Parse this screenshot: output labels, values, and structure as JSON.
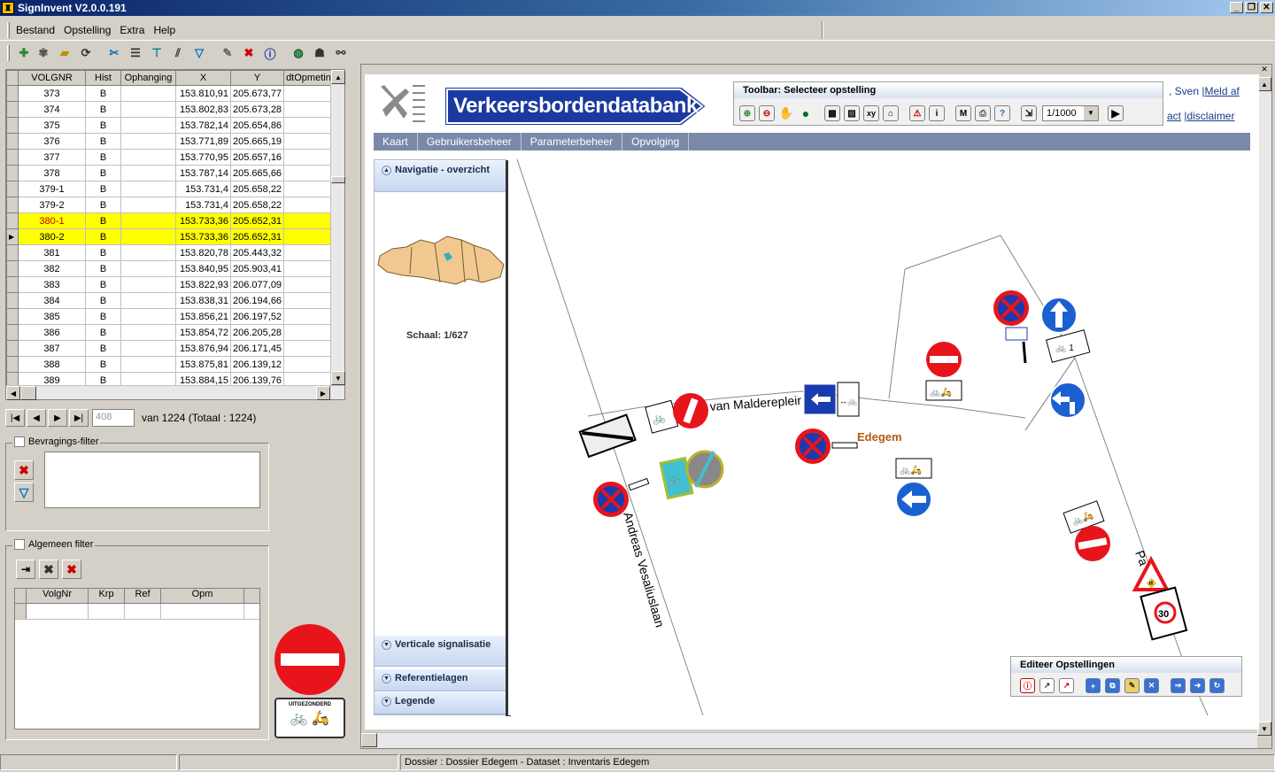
{
  "window": {
    "title": "SignInvent V2.0.0.191"
  },
  "menu": [
    "Bestand",
    "Opstelling",
    "Extra",
    "Help"
  ],
  "grid": {
    "columns": [
      "VOLGNR",
      "Hist",
      "Ophanging",
      "X",
      "Y",
      "dtOpmeting"
    ],
    "rows": [
      [
        "373",
        "B",
        "",
        "153.810,91",
        "205.673,77",
        ""
      ],
      [
        "374",
        "B",
        "",
        "153.802,83",
        "205.673,28",
        ""
      ],
      [
        "375",
        "B",
        "",
        "153.782,14",
        "205.654,86",
        ""
      ],
      [
        "376",
        "B",
        "",
        "153.771,89",
        "205.665,19",
        ""
      ],
      [
        "377",
        "B",
        "",
        "153.770,95",
        "205.657,16",
        ""
      ],
      [
        "378",
        "B",
        "",
        "153.787,14",
        "205.665,66",
        ""
      ],
      [
        "379-1",
        "B",
        "",
        "153.731,4",
        "205.658,22",
        ""
      ],
      [
        "379-2",
        "B",
        "",
        "153.731,4",
        "205.658,22",
        ""
      ],
      [
        "380-1",
        "B",
        "",
        "153.733,36",
        "205.652,31",
        ""
      ],
      [
        "380-2",
        "B",
        "",
        "153.733,36",
        "205.652,31",
        ""
      ],
      [
        "381",
        "B",
        "",
        "153.820,78",
        "205.443,32",
        ""
      ],
      [
        "382",
        "B",
        "",
        "153.840,95",
        "205.903,41",
        ""
      ],
      [
        "383",
        "B",
        "",
        "153.822,93",
        "206.077,09",
        ""
      ],
      [
        "384",
        "B",
        "",
        "153.838,31",
        "206.194,66",
        ""
      ],
      [
        "385",
        "B",
        "",
        "153.856,21",
        "206.197,52",
        ""
      ],
      [
        "386",
        "B",
        "",
        "153.854,72",
        "206.205,28",
        ""
      ],
      [
        "387",
        "B",
        "",
        "153.876,94",
        "206.171,45",
        ""
      ],
      [
        "388",
        "B",
        "",
        "153.875,81",
        "206.139,12",
        ""
      ],
      [
        "389",
        "B",
        "",
        "153.884,15",
        "206.139,76",
        ""
      ]
    ]
  },
  "navigator": {
    "record": "408",
    "summary": "van 1224 (Totaal : 1224)"
  },
  "filters": {
    "query_filter_label": "Bevragings-filter",
    "general_filter_label": "Algemeen filter",
    "general_columns": [
      "VolgNr",
      "Krp",
      "Ref",
      "Opm"
    ]
  },
  "preview_plate_text": "UITGEZONDERD",
  "status": {
    "dossier": "Dossier : Dossier Edegem - Dataset : Inventaris Edegem"
  },
  "web": {
    "banner": "Verkeersbordendatabank",
    "user": ", Sven",
    "logout": "Meld af",
    "contact": "act",
    "disclaimer": "disclaimer",
    "tabs": [
      "Kaart",
      "Gebruikersbeheer",
      "Parameterbeheer",
      "Opvolging"
    ],
    "toolbar_title": "Toolbar: Selecteer opstelling",
    "scale_select": "1/1000",
    "sidebar": {
      "nav_overview": "Navigatie - overzicht",
      "scale": "Schaal: 1/627",
      "vertical": "Verticale signalisatie",
      "reference": "Referentielagen",
      "legend": "Legende"
    },
    "map_labels": {
      "street1": "van Malderepleir",
      "street2": "Andreas Vesaliuslaan",
      "town": "Edegem",
      "street3": "Pa"
    },
    "edit_title": "Editeer Opstellingen"
  },
  "colors": {
    "selection": "#ffff00",
    "tabbar": "#7a89a8",
    "banner_blue": "#1a3aa0"
  }
}
